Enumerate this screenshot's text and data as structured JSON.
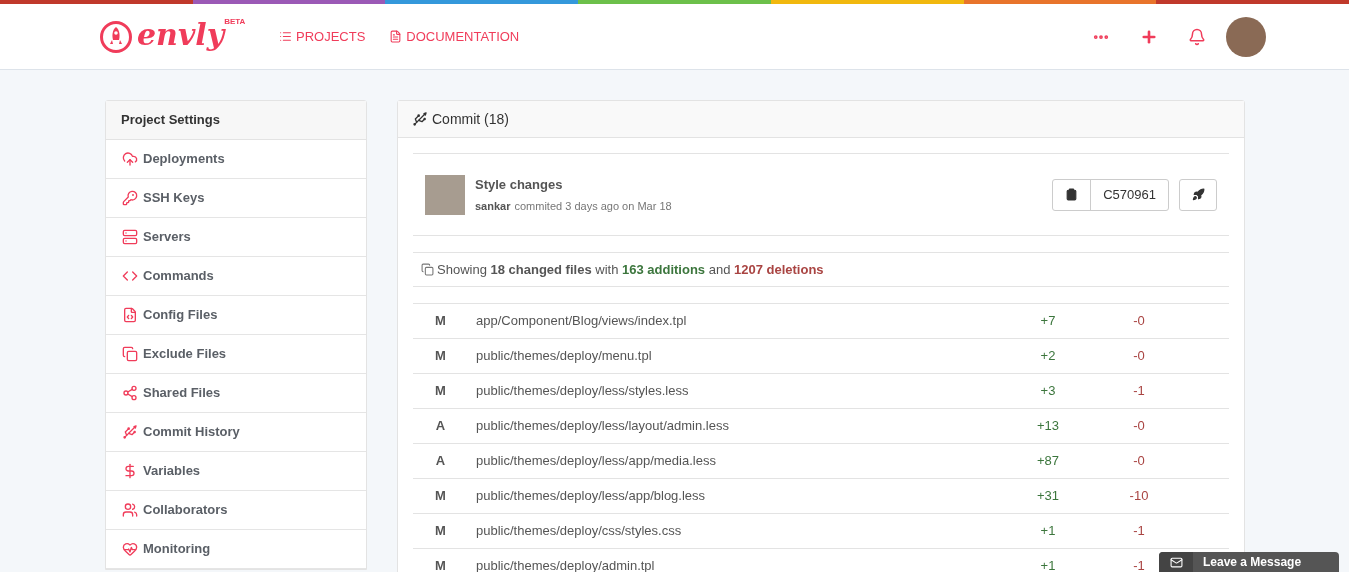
{
  "header": {
    "logo": "envly",
    "logo_badge": "BETA",
    "nav": [
      {
        "label": "PROJECTS"
      },
      {
        "label": "DOCUMENTATION"
      }
    ]
  },
  "sidebar": {
    "title": "Project Settings",
    "items": [
      {
        "label": "Deployments"
      },
      {
        "label": "SSH Keys"
      },
      {
        "label": "Servers"
      },
      {
        "label": "Commands"
      },
      {
        "label": "Config Files"
      },
      {
        "label": "Exclude Files"
      },
      {
        "label": "Shared Files"
      },
      {
        "label": "Commit History"
      },
      {
        "label": "Variables"
      },
      {
        "label": "Collaborators"
      },
      {
        "label": "Monitoring"
      }
    ]
  },
  "commit_panel": {
    "title": "Commit (18)",
    "commit": {
      "message": "Style changes",
      "author": "sankar",
      "meta": "commited 3 days ago on Mar 18",
      "hash": "C570961"
    },
    "summary": [
      {
        "kind": "plain",
        "text": "Showing "
      },
      {
        "kind": "bold",
        "text": "18 changed files"
      },
      {
        "kind": "plain",
        "text": " with "
      },
      {
        "kind": "additions",
        "text": "163 additions"
      },
      {
        "kind": "plain",
        "text": " and "
      },
      {
        "kind": "deletions",
        "text": "1207 deletions"
      }
    ],
    "files": [
      {
        "status": "M",
        "path": "app/Component/Blog/views/index.tpl",
        "additions": "+7",
        "deletions": "-0"
      },
      {
        "status": "M",
        "path": "public/themes/deploy/menu.tpl",
        "additions": "+2",
        "deletions": "-0"
      },
      {
        "status": "M",
        "path": "public/themes/deploy/less/styles.less",
        "additions": "+3",
        "deletions": "-1"
      },
      {
        "status": "A",
        "path": "public/themes/deploy/less/layout/admin.less",
        "additions": "+13",
        "deletions": "-0"
      },
      {
        "status": "A",
        "path": "public/themes/deploy/less/app/media.less",
        "additions": "+87",
        "deletions": "-0"
      },
      {
        "status": "M",
        "path": "public/themes/deploy/less/app/blog.less",
        "additions": "+31",
        "deletions": "-10"
      },
      {
        "status": "M",
        "path": "public/themes/deploy/css/styles.css",
        "additions": "+1",
        "deletions": "-1"
      },
      {
        "status": "M",
        "path": "public/themes/deploy/admin.tpl",
        "additions": "+1",
        "deletions": "-1"
      }
    ]
  },
  "chat_widget": {
    "label": "Leave a Message"
  }
}
